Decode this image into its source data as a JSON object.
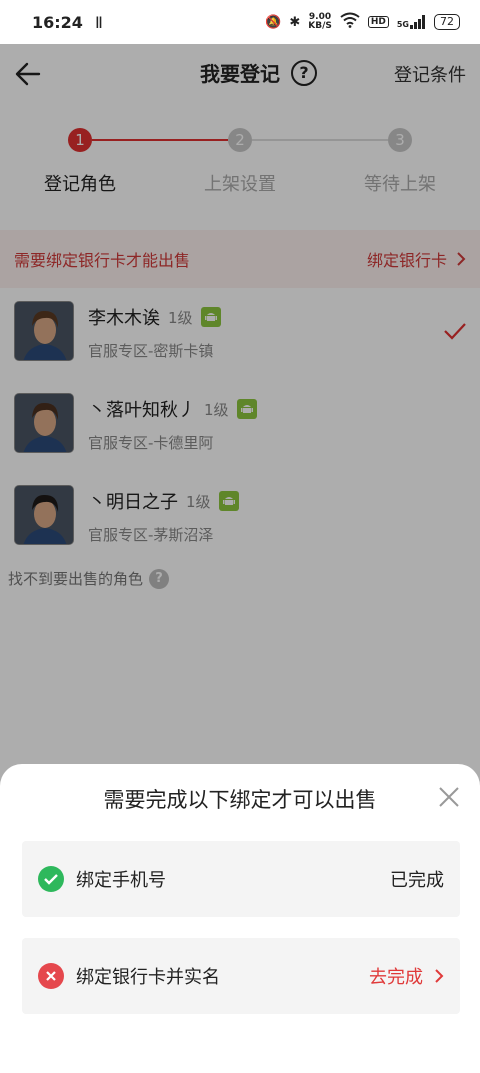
{
  "status_bar": {
    "time": "16:24",
    "left_icon": "Ⅱ",
    "net_speed_value": "9.00",
    "net_speed_unit": "KB/S",
    "hd": "HD",
    "signal": "5G",
    "battery": "72"
  },
  "header": {
    "title": "我要登记",
    "right_label": "登记条件"
  },
  "stepper": {
    "steps": [
      {
        "num": "1",
        "label": "登记角色",
        "active": true
      },
      {
        "num": "2",
        "label": "上架设置",
        "active": false
      },
      {
        "num": "3",
        "label": "等待上架",
        "active": false
      }
    ],
    "active_color": "#e03030",
    "inactive_color": "#c8c8c8"
  },
  "banner": {
    "text": "需要绑定银行卡才能出售",
    "action": "绑定银行卡"
  },
  "roles": [
    {
      "name": "李木木诶",
      "level": "1级",
      "server": "官服专区-密斯卡镇",
      "selected": true
    },
    {
      "name": "丶落叶知秋丿",
      "level": "1级",
      "server": "官服专区-卡德里阿",
      "selected": false
    },
    {
      "name": "丶明日之子",
      "level": "1级",
      "server": "官服专区-茅斯沼泽",
      "selected": false
    }
  ],
  "not_found": {
    "text": "找不到要出售的角色"
  },
  "sheet": {
    "title": "需要完成以下绑定才可以出售",
    "items": [
      {
        "label": "绑定手机号",
        "status": "已完成",
        "done": true
      },
      {
        "label": "绑定银行卡并实名",
        "status": "去完成",
        "done": false
      }
    ],
    "accent": "#e03a3a",
    "success": "#2eb85c"
  }
}
